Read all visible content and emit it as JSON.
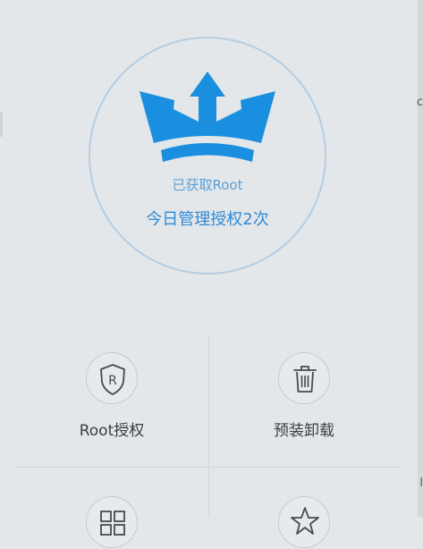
{
  "status": {
    "root_text": "已获取Root",
    "today_text": "今日管理授权2次",
    "accent_color": "#1a8fe0"
  },
  "tiles": [
    {
      "label": "Root授权",
      "icon": "shield-r-icon"
    },
    {
      "label": "预装卸载",
      "icon": "trash-icon"
    },
    {
      "label": "",
      "icon": "grid-icon"
    },
    {
      "label": "",
      "icon": "star-icon"
    }
  ],
  "edge": {
    "top_glyph": "c",
    "bottom_glyph": "l"
  }
}
